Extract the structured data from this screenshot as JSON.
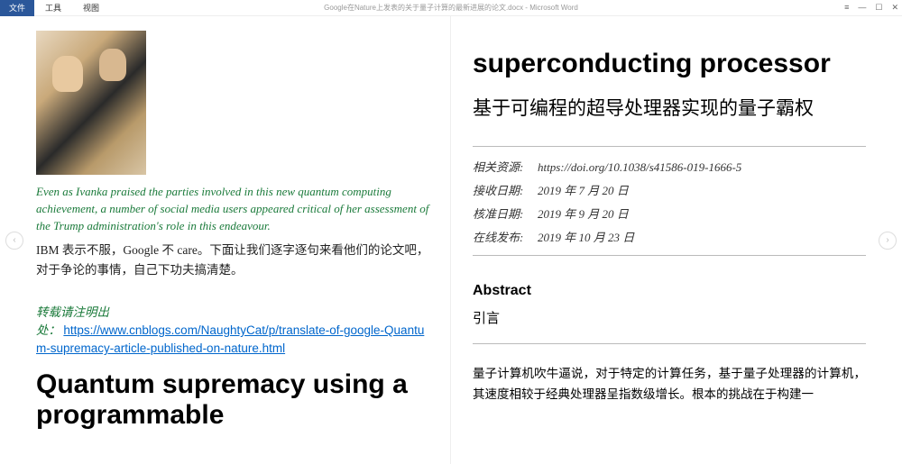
{
  "window": {
    "menu_file": "文件",
    "menu_tools": "工具",
    "menu_view": "视图",
    "title": "Google在Nature上发表的关于量子计算的最新进展的论文.docx - Microsoft Word",
    "ctrl_ribbon": "≡",
    "ctrl_min": "—",
    "ctrl_max": "☐",
    "ctrl_close": "✕"
  },
  "nav": {
    "prev": "‹",
    "next": "›"
  },
  "left": {
    "caption": "Even as Ivanka praised the parties involved in this new quantum computing achievement, a number of social media users appeared critical of her assessment of the Trump administration's role in this endeavour.",
    "body": "IBM 表示不服，Google 不 care。下面让我们逐字逐句来看他们的论文吧，对于争论的事情，自己下功夫搞清楚。",
    "attrib_label": "转载请注明出",
    "attrib_prefix": "处：  ",
    "attrib_link": "https://www.cnblogs.com/NaughtyCat/p/translate-of-google-Quantum-supremacy-article-published-on-nature.html",
    "heading": "Quantum supremacy using a programmable"
  },
  "right": {
    "heading_cont": "superconducting processor",
    "heading_zh": "基于可编程的超导处理器实现的量子霸权",
    "meta": {
      "resource_label": "相关资源:",
      "resource_val": "https://doi.org/10.1038/s41586-019-1666-5",
      "received_label": "接收日期:",
      "received_val": "2019 年 7 月 20 日",
      "approved_label": "核准日期:",
      "approved_val": "2019 年 9 月 20 日",
      "published_label": "在线发布:",
      "published_val": "2019 年 10 月 23 日"
    },
    "abstract_h": "Abstract",
    "abstract_zh": "引言",
    "para": "量子计算机吹牛逼说，对于特定的计算任务，基于量子处理器的计算机，其速度相较于经典处理器呈指数级增长。根本的挑战在于构建一"
  }
}
